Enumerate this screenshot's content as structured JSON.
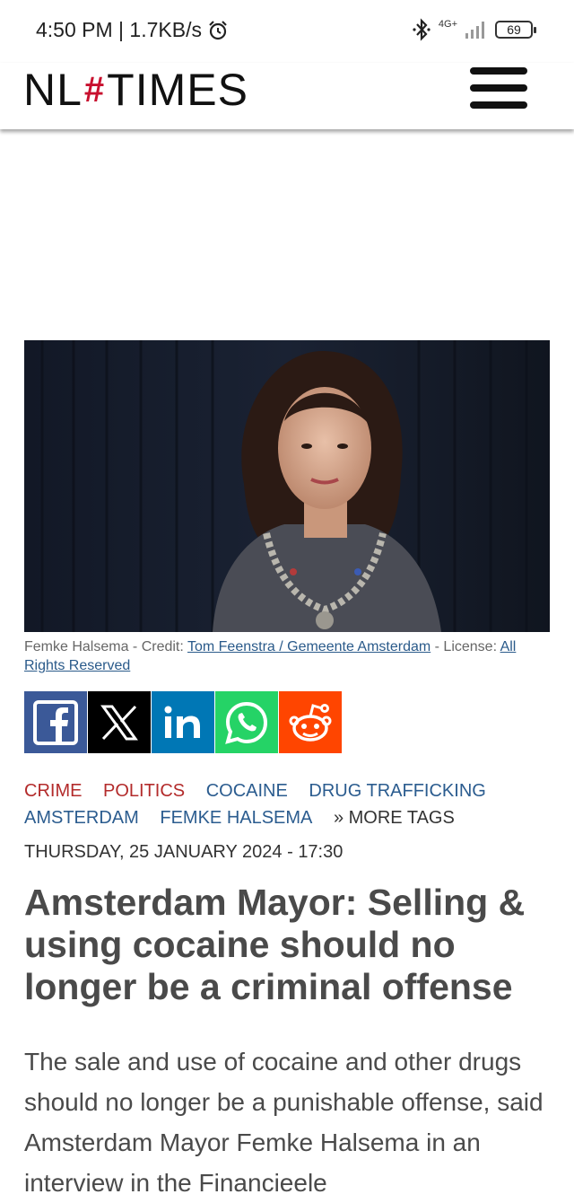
{
  "status_bar": {
    "time": "4:50 PM | 1.7KB/s",
    "network": "4G+",
    "battery": "69"
  },
  "header": {
    "logo_left": "NL",
    "logo_hash": "#",
    "logo_right": "TIMES"
  },
  "hero": {
    "caption_prefix": "Femke Halsema - Credit: ",
    "caption_credit": "Tom Feenstra / Gemeente Amsterdam",
    "caption_license_label": " - License: ",
    "caption_license": "All Rights Reserved"
  },
  "share": {
    "facebook_color": "#3b5998",
    "x_color": "#000000",
    "linkedin_color": "#0077b5",
    "whatsapp_color": "#25d366",
    "reddit_color": "#ff4500"
  },
  "tags": {
    "items": [
      "CRIME",
      "POLITICS",
      "COCAINE",
      "DRUG TRAFFICKING",
      "AMSTERDAM",
      "FEMKE HALSEMA"
    ],
    "more": "» MORE TAGS"
  },
  "article": {
    "date": "THURSDAY, 25 JANUARY 2024 - 17:30",
    "headline": "Amsterdam Mayor: Selling & using cocaine should no longer be a criminal offense",
    "body": "The sale and use of cocaine and other drugs should no longer be a punishable offense, said Amsterdam Mayor Femke Halsema in an interview in the Financieele"
  }
}
